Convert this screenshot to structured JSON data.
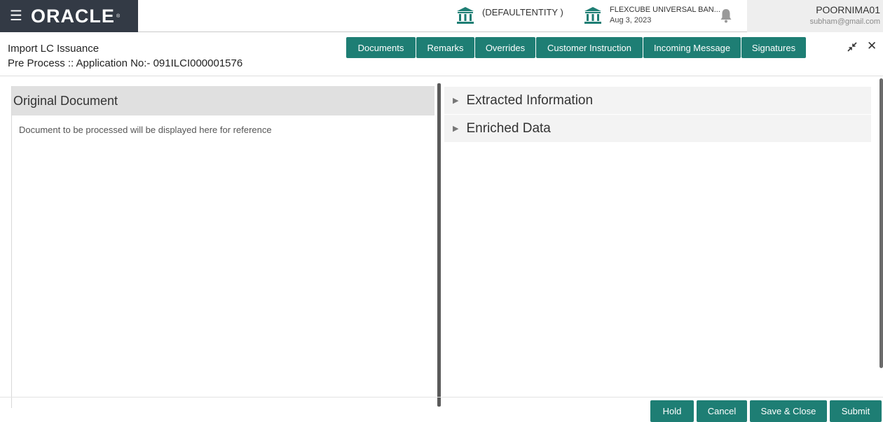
{
  "header": {
    "menu_icon": "hamburger-icon",
    "logo": "ORACLE",
    "entity": "(DEFAULTENTITY )",
    "branch_name": "FLEXCUBE UNIVERSAL BAN...",
    "branch_date": "Aug 3, 2023",
    "user_name": "POORNIMA01",
    "user_email": "subham@gmail.com"
  },
  "subheader": {
    "title": "Import LC Issuance",
    "subtitle": "Pre Process :: Application No:- 091ILCI000001576",
    "tabs": [
      "Documents",
      "Remarks",
      "Overrides",
      "Customer Instruction",
      "Incoming Message",
      "Signatures"
    ]
  },
  "left_panel": {
    "title": "Original Document",
    "description": "Document to be processed will be displayed here for reference"
  },
  "right_panel": {
    "sections": [
      "Extracted Information",
      "Enriched Data"
    ]
  },
  "footer": {
    "buttons": [
      "Hold",
      "Cancel",
      "Save & Close",
      "Submit"
    ]
  },
  "colors": {
    "accent": "#1e7e74",
    "brand_bg": "#333a45",
    "panel_header": "#e0e0e0"
  }
}
